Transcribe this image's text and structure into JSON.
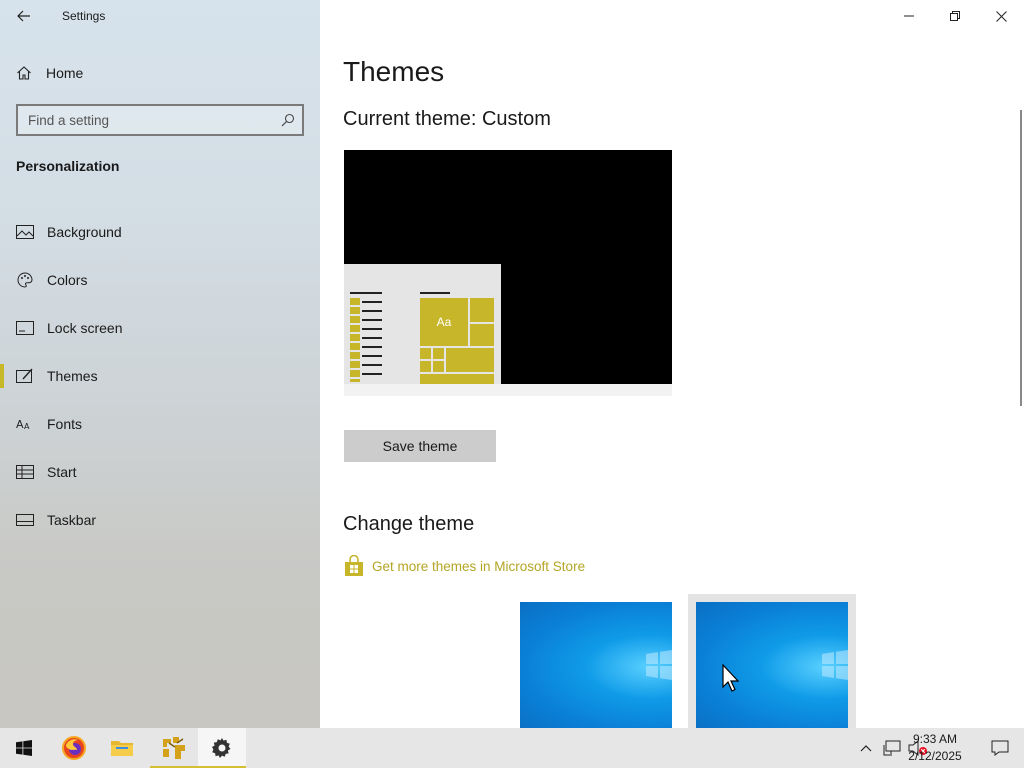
{
  "window": {
    "title": "Settings"
  },
  "sidebar": {
    "home_label": "Home",
    "search_placeholder": "Find a setting",
    "section": "Personalization",
    "items": [
      {
        "label": "Background",
        "icon": "picture-icon"
      },
      {
        "label": "Colors",
        "icon": "palette-icon"
      },
      {
        "label": "Lock screen",
        "icon": "lock-screen-icon"
      },
      {
        "label": "Themes",
        "icon": "brush-icon",
        "selected": true
      },
      {
        "label": "Fonts",
        "icon": "font-icon"
      },
      {
        "label": "Start",
        "icon": "start-tiles-icon"
      },
      {
        "label": "Taskbar",
        "icon": "taskbar-icon"
      }
    ]
  },
  "main": {
    "title": "Themes",
    "current_theme": "Current theme: Custom",
    "preview_tile_text": "Aa",
    "save_button": "Save theme",
    "change_title": "Change theme",
    "store_link": "Get more themes in Microsoft Store"
  },
  "colors": {
    "accent": "#c8b62a",
    "link": "#b4a524"
  },
  "taskbar": {
    "time": "9:33 AM",
    "date": "2/12/2025",
    "apps": [
      "windows-start-icon",
      "firefox-icon",
      "file-explorer-icon",
      "app-icon",
      "settings-gear-icon"
    ]
  }
}
